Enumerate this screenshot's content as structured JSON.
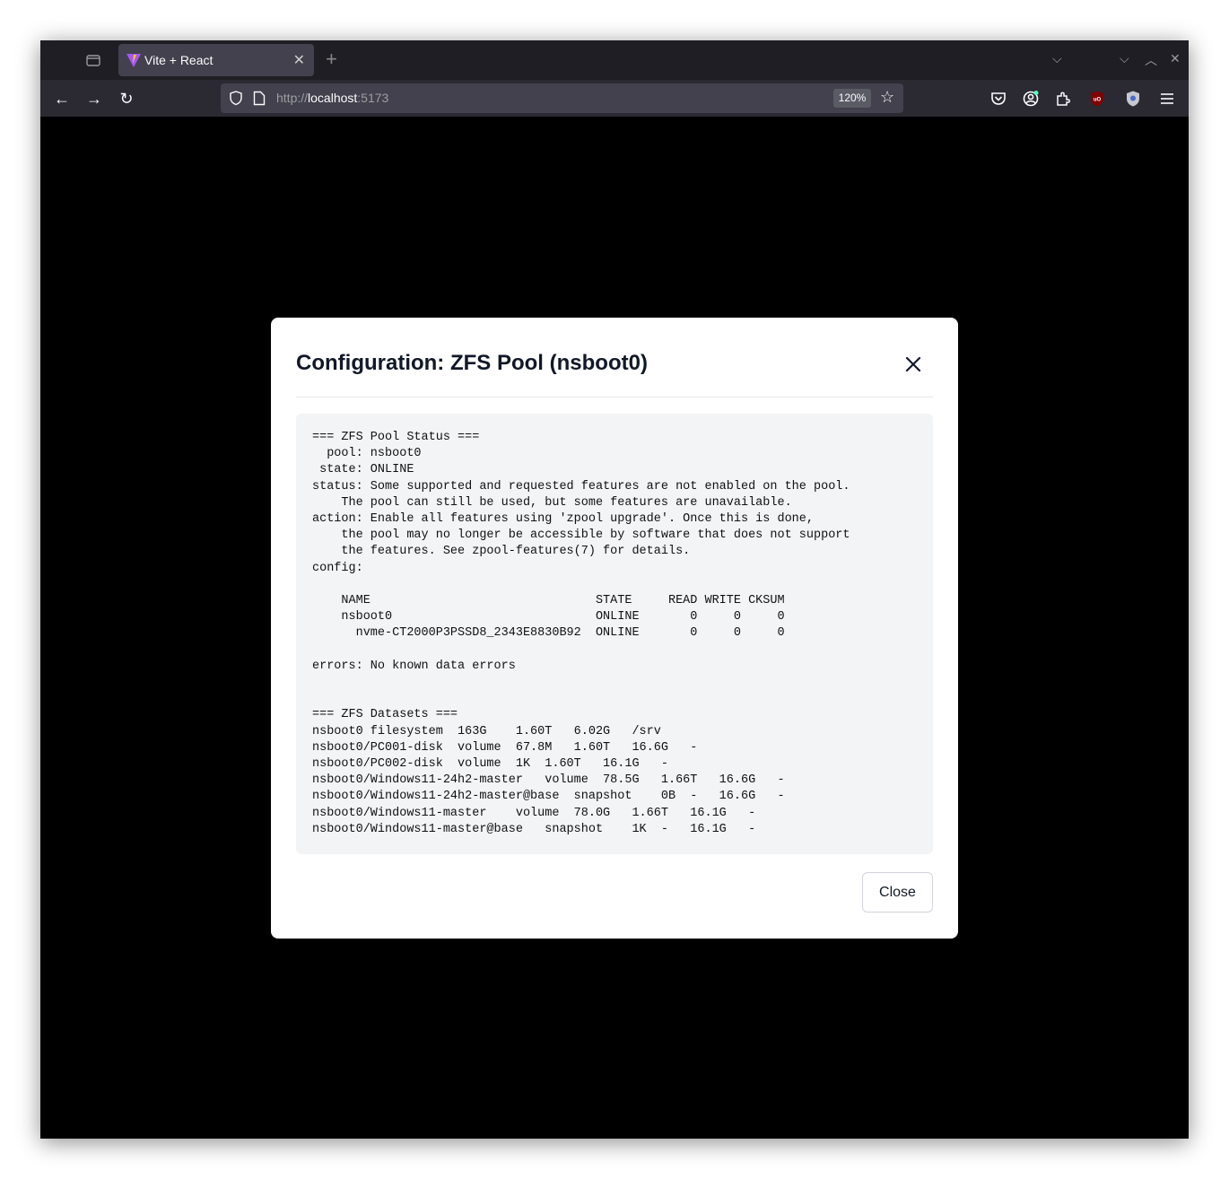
{
  "browser": {
    "tab_title": "Vite + React",
    "url_scheme": "http://",
    "url_host": "localhost",
    "url_port": ":5173",
    "zoom_level": "120%"
  },
  "dialog": {
    "title": "Configuration: ZFS Pool (nsboot0)",
    "content": "=== ZFS Pool Status ===\n  pool: nsboot0\n state: ONLINE\nstatus: Some supported and requested features are not enabled on the pool.\n    The pool can still be used, but some features are unavailable.\naction: Enable all features using 'zpool upgrade'. Once this is done,\n    the pool may no longer be accessible by software that does not support\n    the features. See zpool-features(7) for details.\nconfig:\n\n    NAME                               STATE     READ WRITE CKSUM\n    nsboot0                            ONLINE       0     0     0\n      nvme-CT2000P3PSSD8_2343E8830B92  ONLINE       0     0     0\n\nerrors: No known data errors\n\n\n=== ZFS Datasets ===\nnsboot0 filesystem  163G    1.60T   6.02G   /srv\nnsboot0/PC001-disk  volume  67.8M   1.60T   16.6G   -\nnsboot0/PC002-disk  volume  1K  1.60T   16.1G   -\nnsboot0/Windows11-24h2-master   volume  78.5G   1.66T   16.6G   -\nnsboot0/Windows11-24h2-master@base  snapshot    0B  -   16.6G   -\nnsboot0/Windows11-master    volume  78.0G   1.66T   16.1G   -\nnsboot0/Windows11-master@base   snapshot    1K  -   16.1G   -",
    "close_label": "Close"
  }
}
